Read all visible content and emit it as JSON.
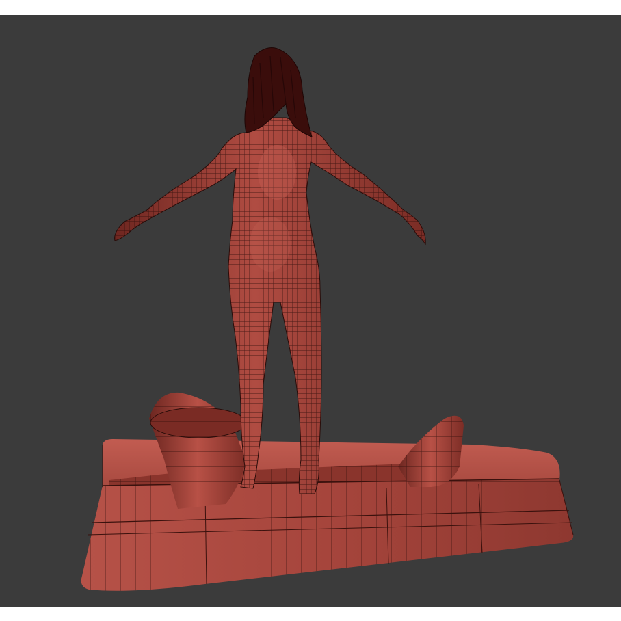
{
  "scene": {
    "background_color": "#3b3b3b",
    "frame_color": "#ffffff",
    "mesh_color": "#a8463d",
    "mesh_highlight": "#c45a50",
    "mesh_shadow": "#6e2620",
    "wire_color": "#2a0c09",
    "hair_color": "#3a0d0b",
    "subject": "wireframe-figure-on-base-icon",
    "prop": "cone-props-icon"
  }
}
